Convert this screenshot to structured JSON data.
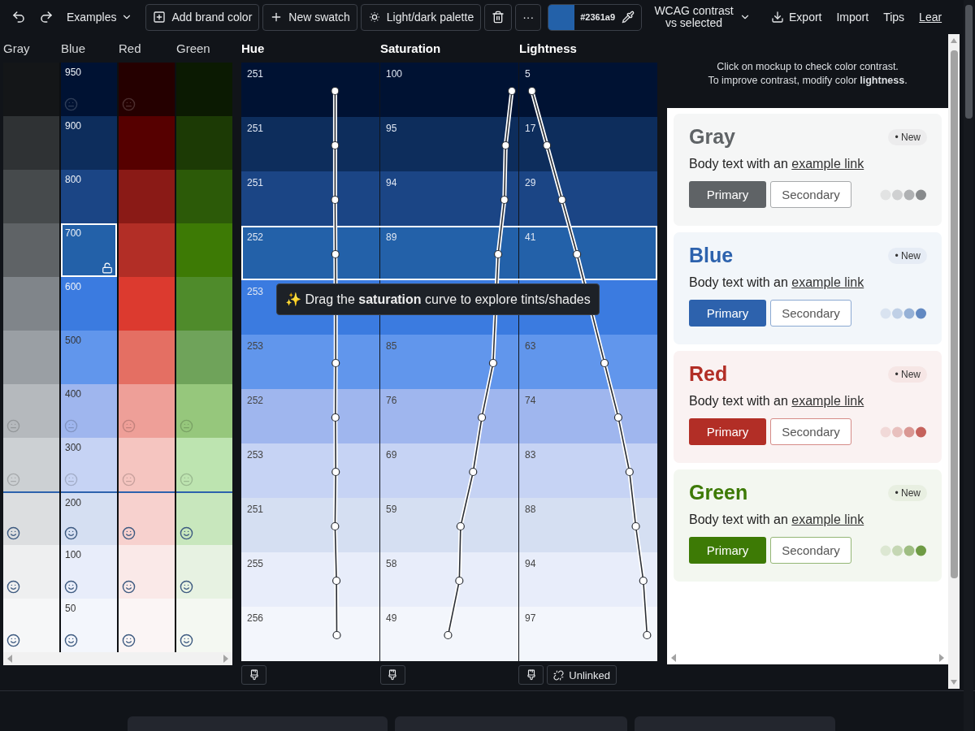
{
  "toolbar": {
    "examples": "Examples",
    "actions": [
      {
        "kind": "add",
        "label": "Add brand color"
      },
      {
        "kind": "new",
        "label": "New swatch"
      },
      {
        "kind": "palette",
        "label": "Light/dark palette"
      }
    ],
    "more": "···",
    "color_value": "#2361a9",
    "contrast_mode": "WCAG contrast vs selected",
    "links": [
      {
        "kind": "export",
        "label": "Export"
      },
      {
        "kind": "plain",
        "label": "Import"
      },
      {
        "kind": "plain",
        "label": "Tips"
      },
      {
        "kind": "underlined",
        "label": "Lear"
      }
    ]
  },
  "palette": {
    "columns": [
      {
        "name": "Gray",
        "swatches": [
          {
            "color": "#141618",
            "selected": false
          },
          {
            "color": "#2f3234",
            "selected": false
          },
          {
            "color": "#464a4c",
            "selected": false
          },
          {
            "color": "#5f6366",
            "selected": false
          },
          {
            "color": "#80858a",
            "selected": false
          },
          {
            "color": "#9a9fa4",
            "selected": false
          },
          {
            "color": "#b5b9bd",
            "selected": false,
            "kind": "neutral"
          },
          {
            "color": "#ccd0d3",
            "selected": false,
            "kind": "neutral"
          },
          {
            "color": "#dcdee0",
            "selected": false,
            "kind": "smile"
          },
          {
            "color": "#eeeff0",
            "selected": false,
            "kind": "smile"
          },
          {
            "color": "#f6f7f8",
            "selected": false,
            "kind": "smile"
          }
        ]
      },
      {
        "name": "Blue",
        "swatches": [
          {
            "label": "950",
            "color": "#001233",
            "selected": false,
            "kind": "neutral"
          },
          {
            "label": "900",
            "color": "#0d2d5c",
            "selected": false
          },
          {
            "label": "800",
            "color": "#1b4585",
            "selected": false
          },
          {
            "label": "700",
            "color": "#2361a9",
            "selected": true
          },
          {
            "label": "600",
            "color": "#3b7be0",
            "selected": false
          },
          {
            "label": "500",
            "color": "#6196ec",
            "selected": false
          },
          {
            "label": "400",
            "color": "#9fb6ee",
            "selected": false,
            "kind": "neutral"
          },
          {
            "label": "300",
            "color": "#c6d3f4",
            "selected": false,
            "kind": "neutral"
          },
          {
            "label": "200",
            "color": "#d5dff2",
            "selected": false,
            "kind": "smile"
          },
          {
            "label": "100",
            "color": "#e8edfa",
            "selected": false,
            "kind": "smile"
          },
          {
            "label": "50",
            "color": "#f3f6fc",
            "selected": false,
            "kind": "smile"
          }
        ]
      },
      {
        "name": "Red",
        "swatches": [
          {
            "color": "#250000",
            "selected": false,
            "kind": "neutral"
          },
          {
            "color": "#560000",
            "selected": false
          },
          {
            "color": "#8a1a16",
            "selected": false
          },
          {
            "color": "#b22e26",
            "selected": false
          },
          {
            "color": "#dc3a2f",
            "selected": false
          },
          {
            "color": "#e46f63",
            "selected": false
          },
          {
            "color": "#ee9f98",
            "selected": false,
            "kind": "neutral"
          },
          {
            "color": "#f5c5c0",
            "selected": false,
            "kind": "neutral"
          },
          {
            "color": "#f7d1ce",
            "selected": false,
            "kind": "smile"
          },
          {
            "color": "#fae9e8",
            "selected": false,
            "kind": "smile"
          },
          {
            "color": "#fbf5f5",
            "selected": false,
            "kind": "smile"
          }
        ]
      },
      {
        "name": "Green",
        "swatches": [
          {
            "color": "#0b1a02",
            "selected": false
          },
          {
            "color": "#1c3a05",
            "selected": false
          },
          {
            "color": "#2c5a08",
            "selected": false
          },
          {
            "color": "#3d7a05",
            "selected": false
          },
          {
            "color": "#4f8b2b",
            "selected": false
          },
          {
            "color": "#6fa35a",
            "selected": false
          },
          {
            "color": "#96c77c",
            "selected": false,
            "kind": "neutral"
          },
          {
            "color": "#bde4b0",
            "selected": false,
            "kind": "neutral"
          },
          {
            "color": "#c8e7bd",
            "selected": false,
            "kind": "smile"
          },
          {
            "color": "#e7f2e2",
            "selected": false,
            "kind": "smile"
          },
          {
            "color": "#f4f8f2",
            "selected": false,
            "kind": "smile"
          }
        ]
      }
    ]
  },
  "curves": {
    "columns": [
      {
        "kind": "hue",
        "label": "Hue"
      },
      {
        "kind": "saturation",
        "label": "Saturation"
      },
      {
        "kind": "lightness",
        "label": "Lightness"
      }
    ],
    "rows": [
      {
        "hue": "251",
        "saturation": "100",
        "lightness": "5",
        "selected": false
      },
      {
        "hue": "251",
        "saturation": "95",
        "lightness": "17",
        "selected": false
      },
      {
        "hue": "251",
        "saturation": "94",
        "lightness": "29",
        "selected": false
      },
      {
        "hue": "252",
        "saturation": "89",
        "lightness": "41",
        "selected": true
      },
      {
        "hue": "253",
        "selected": false
      },
      {
        "hue": "253",
        "saturation": "85",
        "lightness": "63",
        "selected": false
      },
      {
        "hue": "252",
        "saturation": "76",
        "lightness": "74",
        "selected": false
      },
      {
        "hue": "253",
        "saturation": "69",
        "lightness": "83",
        "selected": false
      },
      {
        "hue": "251",
        "saturation": "59",
        "lightness": "88",
        "selected": false
      },
      {
        "hue": "255",
        "saturation": "58",
        "lightness": "94",
        "selected": false
      },
      {
        "hue": "256",
        "saturation": "49",
        "lightness": "97",
        "selected": false
      }
    ],
    "tooltip": "✨ Drag the **saturation** curve to explore tints/shades",
    "unlink_button": "Unlinked"
  },
  "preview": {
    "hint": [
      "Click on mockup to check color contrast.",
      "To improve contrast, modify color **lightness**."
    ],
    "cards": [
      {
        "title": "Gray",
        "badge": "• New",
        "body": "Body text with an",
        "link": "example link",
        "primary": "Primary",
        "secondary": "Secondary",
        "color": "#5f6366"
      },
      {
        "title": "Blue",
        "badge": "• New",
        "body": "Body text with an",
        "link": "example link",
        "primary": "Primary",
        "secondary": "Secondary",
        "color": "#2d62ad"
      },
      {
        "title": "Red",
        "badge": "• New",
        "body": "Body text with an",
        "link": "example link",
        "primary": "Primary",
        "secondary": "Secondary",
        "color": "#b22e26"
      },
      {
        "title": "Green",
        "badge": "• New",
        "body": "Body text with an",
        "link": "example link",
        "primary": "Primary",
        "secondary": "Secondary",
        "color": "#3d7a05"
      }
    ]
  }
}
